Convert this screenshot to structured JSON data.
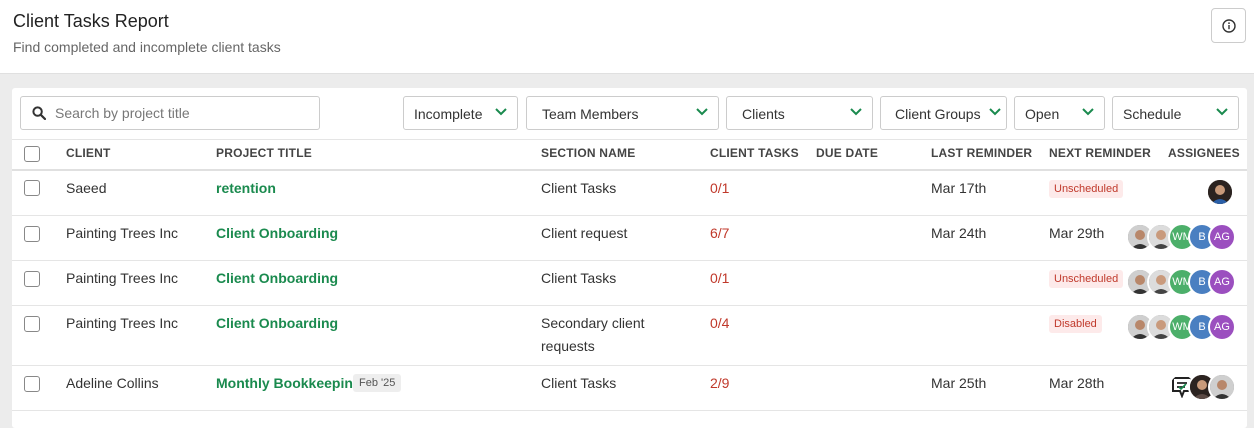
{
  "header": {
    "title": "Client Tasks Report",
    "subtitle": "Find completed and incomplete client tasks",
    "info_icon": "info-icon"
  },
  "search": {
    "placeholder": "Search by project title",
    "value": ""
  },
  "filters": [
    {
      "label": "Incomplete"
    },
    {
      "label": "Team Members"
    },
    {
      "label": "Clients"
    },
    {
      "label": "Client Groups"
    },
    {
      "label": "Open"
    },
    {
      "label": "Schedule"
    }
  ],
  "columns": {
    "client": "CLIENT",
    "project_title": "PROJECT TITLE",
    "section_name": "SECTION NAME",
    "client_tasks": "CLIENT TASKS",
    "due_date": "DUE DATE",
    "last_reminder": "LAST REMINDER",
    "next_reminder": "NEXT REMINDER",
    "assignees": "ASSIGNEES"
  },
  "rows": [
    {
      "client": "Saeed",
      "project": "retention",
      "section": "Client Tasks",
      "tasks": "0/1",
      "due": "",
      "last": "Mar 17th",
      "next_badge": "Unscheduled",
      "assignees": [
        "photo-woman"
      ]
    },
    {
      "client": "Painting Trees Inc",
      "project": "Client Onboarding",
      "section": "Client request",
      "tasks": "6/7",
      "due": "",
      "last": "Mar 24th",
      "next": "Mar 29th",
      "assignees": [
        "photo-man-1",
        "photo-man-2",
        "WM",
        "B",
        "AG"
      ]
    },
    {
      "client": "Painting Trees Inc",
      "project": "Client Onboarding",
      "section": "Client Tasks",
      "tasks": "0/1",
      "due": "",
      "last": "",
      "next_badge": "Unscheduled",
      "assignees": [
        "photo-man-1",
        "photo-man-2",
        "WM",
        "B",
        "AG"
      ]
    },
    {
      "client": "Painting Trees Inc",
      "project": "Client Onboarding",
      "section_line1": "Secondary client",
      "section_line2": "requests",
      "tasks": "0/4",
      "due": "",
      "last": "",
      "next_badge": "Disabled",
      "assignees": [
        "photo-man-1",
        "photo-man-2",
        "WM",
        "B",
        "AG"
      ]
    },
    {
      "client": "Adeline Collins",
      "project": "Monthly Bookkeeping",
      "tag": "Feb '25",
      "section": "Client Tasks",
      "tasks": "2/9",
      "due": "",
      "last": "Mar 25th",
      "next": "Mar 28th",
      "assignees": [
        "chat-icon",
        "photo-woman",
        "photo-man-1"
      ]
    }
  ],
  "colors": {
    "link": "#1a8a4e",
    "count": "#c0392b",
    "badge_bg": "#fdeaea",
    "chevron": "#1a8a4e",
    "avatar_WM": "#4caf6a",
    "avatar_B": "#4a7fc1",
    "avatar_AG": "#9b4fbf"
  }
}
